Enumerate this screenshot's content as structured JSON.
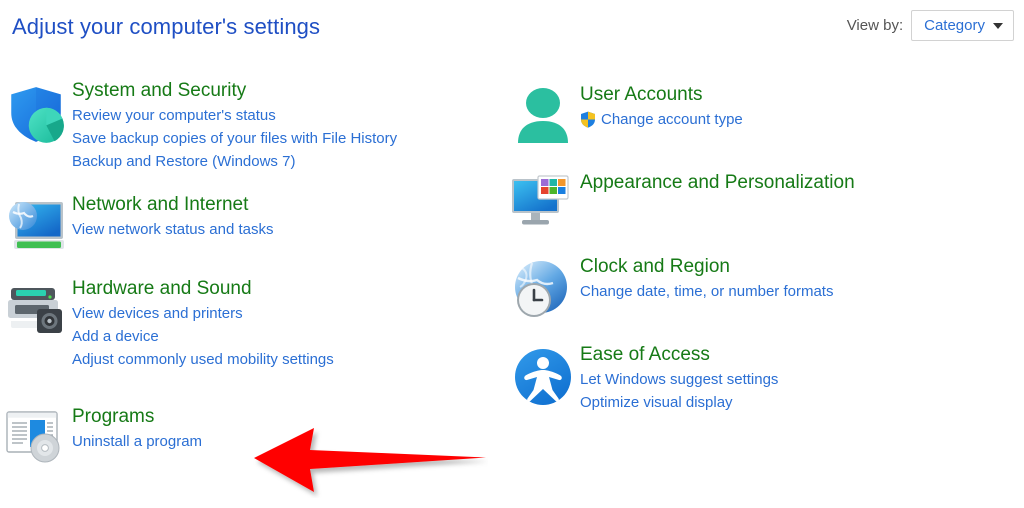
{
  "header": {
    "title": "Adjust your computer's settings",
    "view_by_label": "View by:",
    "view_by_value": "Category",
    "caret_icon": "chevron-down-icon"
  },
  "colors": {
    "title_blue": "#1f4fc4",
    "heading_green": "#167a16",
    "link_blue": "#2b6fd4",
    "label_gray": "#555555",
    "box_border": "#d2d2d2",
    "arrow_red": "#ff0000",
    "teal": "#2bbfa0",
    "shield_blue": "#1d7fe0"
  },
  "columns": {
    "left": [
      {
        "id": "system-and-security",
        "icon": "shield-pie-icon",
        "heading": "System and Security",
        "links": [
          "Review your computer's status",
          "Save backup copies of your files with File History",
          "Backup and Restore (Windows 7)"
        ]
      },
      {
        "id": "network-and-internet",
        "icon": "globe-monitor-icon",
        "heading": "Network and Internet",
        "links": [
          "View network status and tasks"
        ]
      },
      {
        "id": "hardware-and-sound",
        "icon": "printer-device-icon",
        "heading": "Hardware and Sound",
        "links": [
          "View devices and printers",
          "Add a device",
          "Adjust commonly used mobility settings"
        ]
      },
      {
        "id": "programs",
        "icon": "window-disc-icon",
        "heading": "Programs",
        "links": [
          "Uninstall a program"
        ]
      }
    ],
    "right": [
      {
        "id": "user-accounts",
        "icon": "user-person-icon",
        "heading": "User Accounts",
        "links": [
          "Change account type"
        ],
        "link_badge": "uac-shield-icon"
      },
      {
        "id": "appearance-and-personalization",
        "icon": "monitor-swatches-icon",
        "heading": "Appearance and Personalization",
        "links": []
      },
      {
        "id": "clock-and-region",
        "icon": "globe-clock-icon",
        "heading": "Clock and Region",
        "links": [
          "Change date, time, or number formats"
        ]
      },
      {
        "id": "ease-of-access",
        "icon": "accessibility-icon",
        "heading": "Ease of Access",
        "links": [
          "Let Windows suggest settings",
          "Optimize visual display"
        ]
      }
    ]
  },
  "annotation": {
    "type": "arrow",
    "direction": "left",
    "color": "#ff0000",
    "points_at": "Uninstall a program"
  }
}
